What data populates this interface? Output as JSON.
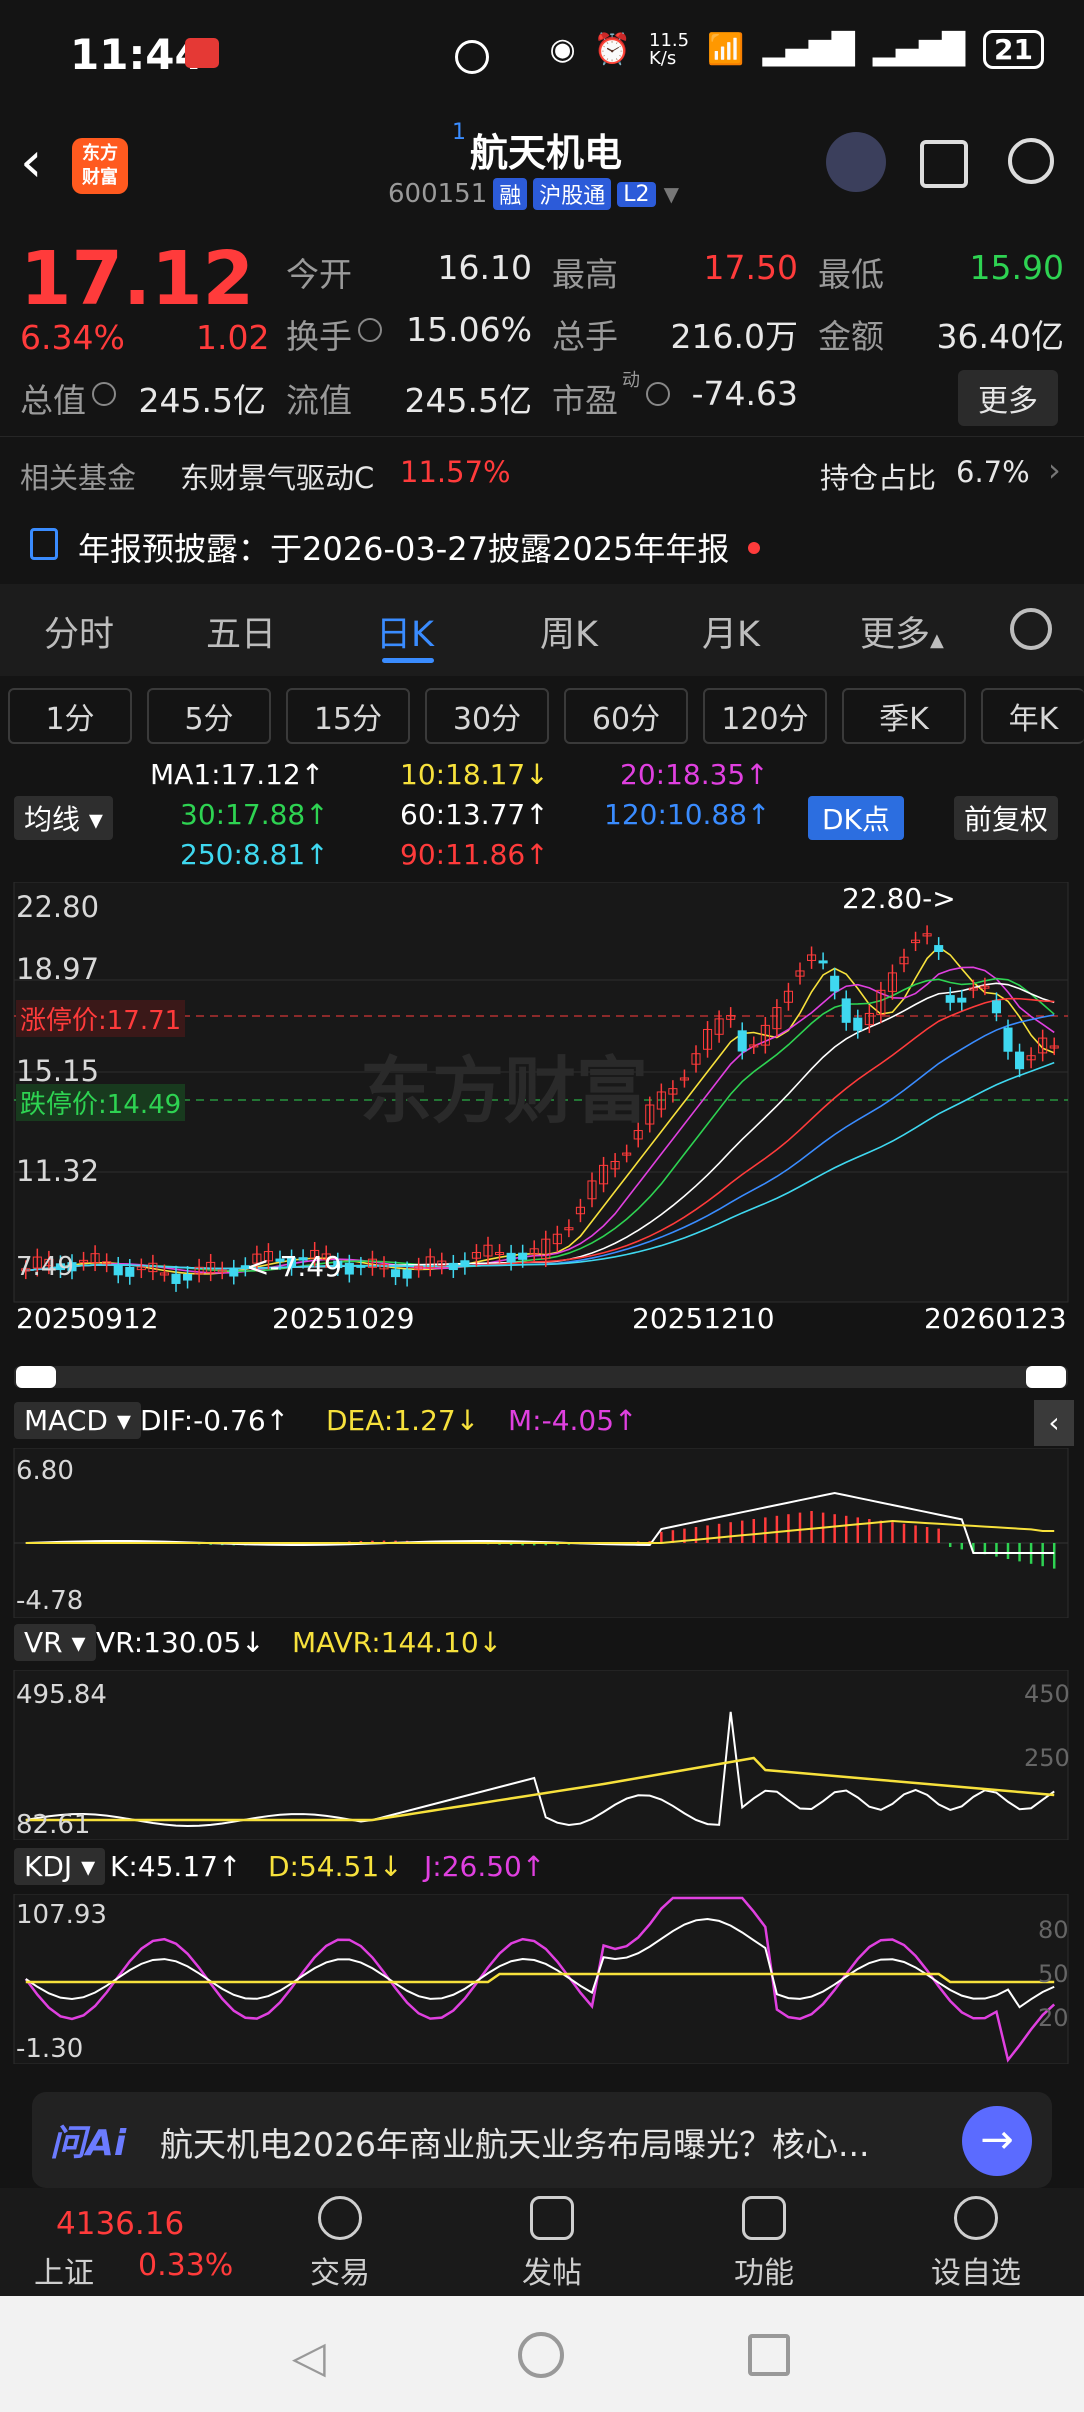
{
  "status": {
    "time": "11:44",
    "net_speed": "11.5\nK/s",
    "battery": "21"
  },
  "header": {
    "stock_name": "航天机电",
    "superscript": "1",
    "code": "600151",
    "tags": [
      "融",
      "沪股通",
      "L2"
    ],
    "logo_text": "东方\n财富"
  },
  "quote": {
    "price": "17.12",
    "change_pct": "6.34%",
    "change": "1.02",
    "open_label": "今开",
    "open": "16.10",
    "high_label": "最高",
    "high": "17.50",
    "low_label": "最低",
    "low": "15.90",
    "turnover_label": "换手",
    "turnover": "15.06%",
    "volume_label": "总手",
    "volume": "216.0万",
    "amount_label": "金额",
    "amount": "36.40亿",
    "mcap_label": "总值",
    "mcap": "245.5亿",
    "float_label": "流值",
    "float": "245.5亿",
    "pe_label": "市盈",
    "pe_sup": "动",
    "pe": "-74.63",
    "more": "更多"
  },
  "fund": {
    "label": "相关基金",
    "name": "东财景气驱动C",
    "pct": "11.57%",
    "hold_label": "持仓占比",
    "hold": "6.7%"
  },
  "notice": "年报预披露：于2026-03-27披露2025年年报",
  "tabs": [
    "分时",
    "五日",
    "日K",
    "周K",
    "月K",
    "更多"
  ],
  "periods": [
    "1分",
    "5分",
    "15分",
    "30分",
    "60分",
    "120分",
    "季K",
    "年K"
  ],
  "ma": {
    "toggle": "均线",
    "ma1": "MA1:17.12↑",
    "ma10": "10:18.17↓",
    "ma20": "20:18.35↑",
    "ma30": "30:17.88↑",
    "ma60": "60:13.77↑",
    "ma120": "120:10.88↑",
    "ma250": "250:8.81↑",
    "ma90": "90:11.86↑",
    "dk": "DK点",
    "adjust": "前复权"
  },
  "kchart": {
    "y_labels": [
      "22.80",
      "18.97",
      "15.15",
      "11.32",
      "7.49"
    ],
    "limit_up": "涨停价:17.71",
    "limit_down": "跌停价:14.49",
    "dates": [
      "20250912",
      "20251029",
      "20251210",
      "20260123"
    ],
    "high_mark": "22.80->",
    "low_mark": "<-7.49",
    "watermark": "东方财富"
  },
  "macd": {
    "name": "MACD",
    "dif": "DIF:-0.76↑",
    "dea": "DEA:1.27↓",
    "m": "M:-4.05↑",
    "top": "6.80",
    "bottom": "-4.78"
  },
  "vr": {
    "name": "VR",
    "vr": "VR:130.05↓",
    "mavr": "MAVR:144.10↓",
    "top": "495.84",
    "bottom": "82.61",
    "r1": "450",
    "r2": "250"
  },
  "kdj": {
    "name": "KDJ",
    "k": "K:45.17↑",
    "d": "D:54.51↓",
    "j": "J:26.50↑",
    "top": "107.93",
    "bottom": "-1.30",
    "r1": "80",
    "r2": "50",
    "r3": "20"
  },
  "ai": {
    "brand": "问Ai",
    "text": "航天机电2026年商业航天业务布局曝光？核心..."
  },
  "bottom_nav": {
    "index_value": "4136.16",
    "index_name": "上证",
    "index_pct": "0.33%",
    "items": [
      "交易",
      "发帖",
      "功能",
      "设自选"
    ]
  },
  "colors": {
    "up": "#ff3b3b",
    "down": "#2ed352",
    "accent": "#3a8cff"
  }
}
